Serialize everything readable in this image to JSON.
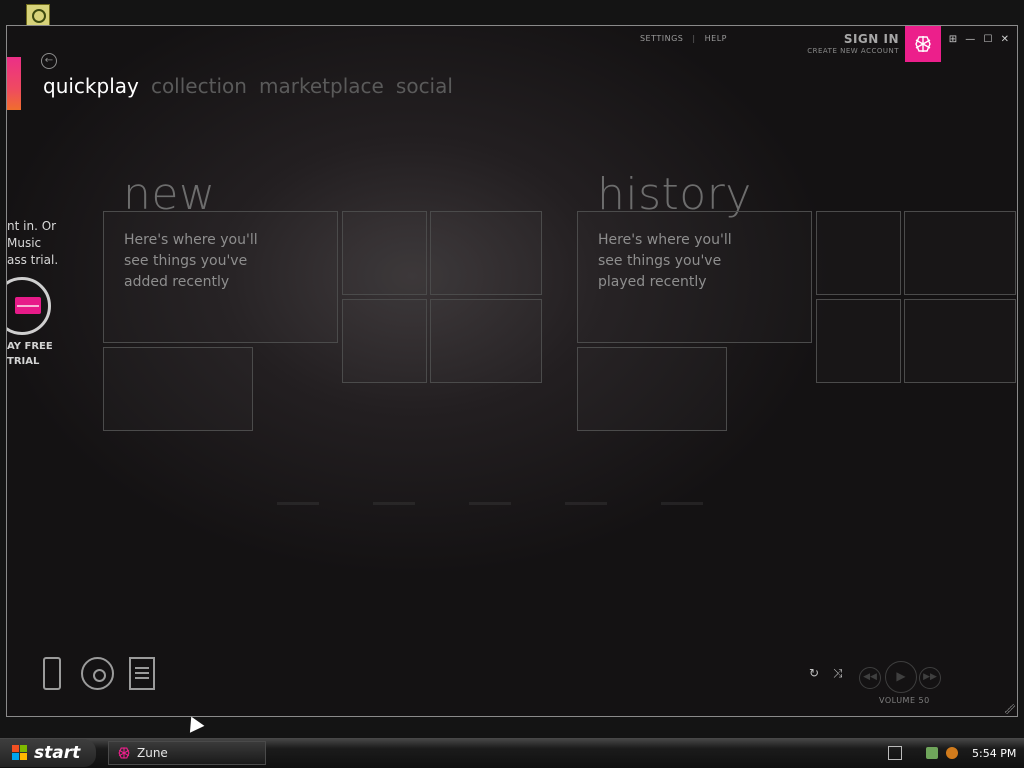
{
  "desktop": {
    "taskbar": {
      "start_label": "start",
      "task_label": "Zune",
      "clock": "5:54 PM"
    }
  },
  "app": {
    "nav": [
      "quickplay",
      "collection",
      "marketplace",
      "social"
    ],
    "topbar": {
      "settings": "SETTINGS",
      "help": "HELP",
      "sign_in": "SIGN IN",
      "create_account": "CREATE NEW ACCOUNT"
    },
    "sidebar": {
      "lines": [
        "nt in. Or",
        "Music",
        "ass trial."
      ],
      "trial_lines": [
        "AY FREE",
        "TRIAL"
      ]
    },
    "sections": {
      "new": {
        "title": "new",
        "message_lines": [
          "Here's where you'll",
          "see things you've",
          "added recently"
        ]
      },
      "history": {
        "title": "history",
        "message_lines": [
          "Here's where you'll",
          "see things you've",
          "played recently"
        ]
      }
    },
    "player": {
      "volume": "VOLUME 50"
    }
  },
  "colors": {
    "accent": "#EC1F8B",
    "background": "#1C191A",
    "tile_border": "#4B4B4B",
    "text_muted": "#8E8E8E"
  },
  "icons": {
    "back": "back-icon",
    "logo": "zune-logo-icon",
    "device": "device-icon",
    "disc": "disc-icon",
    "playlist": "playlist-icon",
    "repeat": "repeat-icon",
    "shuffle": "shuffle-icon",
    "previous": "previous-icon",
    "play": "play-icon",
    "next": "next-icon"
  }
}
